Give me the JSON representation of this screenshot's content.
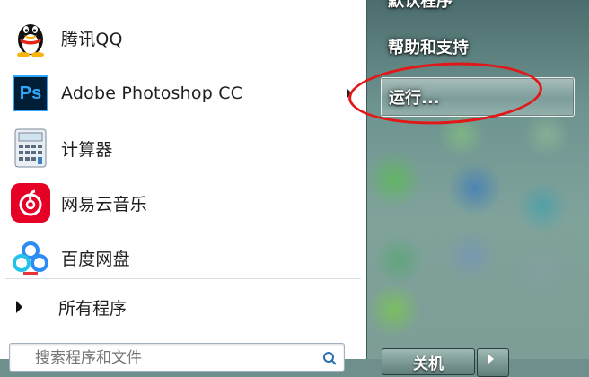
{
  "programs": [
    {
      "label": "腾讯QQ",
      "icon": "qq-penguin-icon"
    },
    {
      "label": "Adobe Photoshop CC",
      "icon": "photoshop-icon",
      "icon_text": "Ps",
      "has_submenu": true
    },
    {
      "label": "计算器",
      "icon": "calculator-icon"
    },
    {
      "label": "网易云音乐",
      "icon": "netease-music-icon"
    },
    {
      "label": "百度网盘",
      "icon": "baidu-netdisk-icon"
    }
  ],
  "all_programs": {
    "label": "所有程序"
  },
  "search": {
    "placeholder": "搜索程序和文件"
  },
  "right_menu": {
    "top_partial": "默认程序",
    "help": "帮助和支持",
    "run": "运行..."
  },
  "shutdown": {
    "label": "关机"
  },
  "colors": {
    "highlight_annotation": "#e21818",
    "photoshop_bg": "#001e36",
    "photoshop_text": "#31a8ff",
    "netease_red": "#e60026",
    "baidu_blue": "#2c8cf4"
  }
}
